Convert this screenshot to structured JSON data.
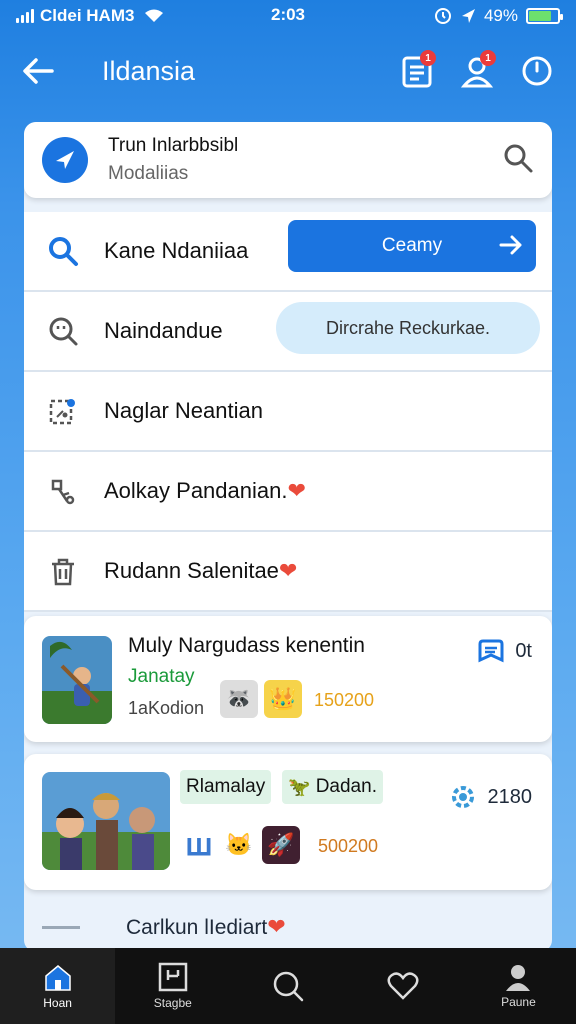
{
  "status": {
    "carrier": "Cldei HAM3",
    "time": "2:03",
    "battery": "49%"
  },
  "header": {
    "title": "Ildansia",
    "badges": [
      "1",
      "1"
    ]
  },
  "search": {
    "title": "Trun Inlarbbsibl",
    "subtitle": "Modaliias"
  },
  "menu": [
    {
      "label": "Kane Ndaniiaa",
      "icon": "search-icon",
      "button": "Ceamy"
    },
    {
      "label": "Naindandue",
      "icon": "clock-search-icon",
      "button": "Dircrahe Reckurkae."
    },
    {
      "label": "Naglar Neantian",
      "icon": "share-icon"
    },
    {
      "label": "Aolkay Pandanian.",
      "icon": "key-icon",
      "heart": "❤"
    },
    {
      "label": "Rudann Salenitae",
      "icon": "trash-icon",
      "heart": "❤"
    }
  ],
  "cards": [
    {
      "title": "Muly Nargudass kenentin",
      "subtitle": "Janatay",
      "meta": "1aKodion",
      "score": "150200",
      "right_value": "0t",
      "icon": "bookmark-icon"
    },
    {
      "tag1": "Rlamalay",
      "tag2": "Dadan.",
      "score": "500200",
      "right_value": "2180",
      "icon": "gear-icon"
    }
  ],
  "partial": {
    "label": "Carlkun lIediart",
    "heart": "❤"
  },
  "nav": [
    {
      "label": "Hoan",
      "icon": "home-icon"
    },
    {
      "label": "Stagbe",
      "icon": "grid-icon"
    },
    {
      "label": "",
      "icon": "search-icon"
    },
    {
      "label": "",
      "icon": "heart-icon"
    },
    {
      "label": "Paune",
      "icon": "profile-icon"
    }
  ],
  "colors": {
    "primary": "#1b74e0",
    "heart": "#ea4b3b",
    "green": "#1a9a3a",
    "gold": "#e6a21a"
  }
}
